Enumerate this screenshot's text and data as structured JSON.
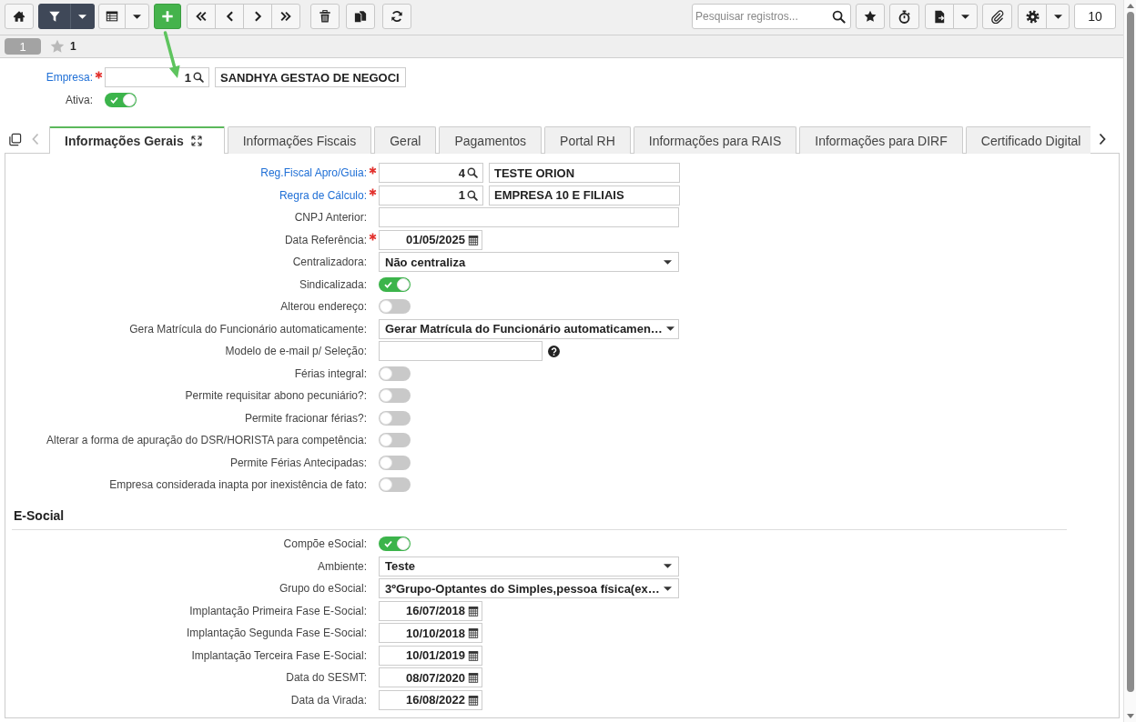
{
  "toolbar": {
    "filter_active": true,
    "search": {
      "placeholder": "Pesquisar registros..."
    },
    "page_size": "10"
  },
  "record_bar": {
    "badge": "1",
    "favorite": false,
    "title": "1"
  },
  "header": [
    {
      "kind": "lookup",
      "label": "Empresa:",
      "required": true,
      "code": "1",
      "description": "SANDHYA GESTAO DE NEGOCI"
    },
    {
      "kind": "toggle",
      "label": "Ativa:",
      "required": false,
      "on": true
    }
  ],
  "tab_nav": {
    "prev_disabled": true,
    "next_disabled": false
  },
  "tabs": [
    {
      "label": "Informações Gerais",
      "selected": true
    },
    {
      "label": "Informações Fiscais",
      "selected": false
    },
    {
      "label": "Geral",
      "selected": false
    },
    {
      "label": "Pagamentos",
      "selected": false
    },
    {
      "label": "Portal RH",
      "selected": false
    },
    {
      "label": "Informações para RAIS",
      "selected": false
    },
    {
      "label": "Informações para DIRF",
      "selected": false
    },
    {
      "label": "Certificado Digital",
      "selected": false
    }
  ],
  "form": [
    {
      "kind": "lookup",
      "label": "Reg.Fiscal Apro/Guia:",
      "required": true,
      "code": "4",
      "description": "TESTE ORION"
    },
    {
      "kind": "lookup",
      "label": "Regra de Cálculo:",
      "required": true,
      "code": "1",
      "description": "EMPRESA 10 E FILIAIS"
    },
    {
      "kind": "text",
      "label": "CNPJ Anterior:",
      "required": false,
      "help": false
    },
    {
      "kind": "date",
      "label": "Data Referência:",
      "required": true,
      "value": "01/05/2025"
    },
    {
      "kind": "select",
      "label": "Centralizadora:",
      "required": false,
      "value": "Não centraliza"
    },
    {
      "kind": "toggle",
      "label": "Sindicalizada:",
      "required": false,
      "on": true
    },
    {
      "kind": "toggle",
      "label": "Alterou endereço:",
      "required": false,
      "on": false
    },
    {
      "kind": "select",
      "label": "Gera Matrícula do Funcionário automaticamente:",
      "required": false,
      "value": "Gerar Matrícula do Funcionário automaticamen…"
    },
    {
      "kind": "text",
      "label": "Modelo de e-mail p/ Seleção:",
      "required": false,
      "help": true
    },
    {
      "kind": "toggle",
      "label": "Férias integral:",
      "required": false,
      "on": false
    },
    {
      "kind": "toggle",
      "label": "Permite requisitar abono pecuniário?:",
      "required": false,
      "on": false
    },
    {
      "kind": "toggle",
      "label": "Permite fracionar férias?:",
      "required": false,
      "on": false
    },
    {
      "kind": "toggle",
      "label": "Alterar a forma de apuração do DSR/HORISTA para competência:",
      "required": false,
      "on": false
    },
    {
      "kind": "toggle",
      "label": "Permite Férias Antecipadas:",
      "required": false,
      "on": false
    },
    {
      "kind": "toggle",
      "label": "Empresa considerada inapta por inexistência de fato:",
      "required": false,
      "on": false
    }
  ],
  "esocial": {
    "title": "E-Social",
    "fields": [
      {
        "kind": "toggle",
        "label": "Compõe eSocial:",
        "required": false,
        "on": true
      },
      {
        "kind": "select",
        "label": "Ambiente:",
        "required": false,
        "value": "Teste"
      },
      {
        "kind": "select",
        "label": "Grupo do eSocial:",
        "required": false,
        "value": "3ºGrupo-Optantes do Simples,pessoa física(ex…"
      },
      {
        "kind": "date",
        "label": "Implantação Primeira Fase E-Social:",
        "required": false,
        "value": "16/07/2018"
      },
      {
        "kind": "date",
        "label": "Implantação Segunda Fase E-Social:",
        "required": false,
        "value": "10/10/2018"
      },
      {
        "kind": "date",
        "label": "Implantação Terceira Fase E-Social:",
        "required": false,
        "value": "10/01/2019"
      },
      {
        "kind": "date",
        "label": "Data do SESMT:",
        "required": false,
        "value": "08/07/2020"
      },
      {
        "kind": "date",
        "label": "Data da Virada:",
        "required": false,
        "value": "16/08/2022"
      }
    ]
  }
}
